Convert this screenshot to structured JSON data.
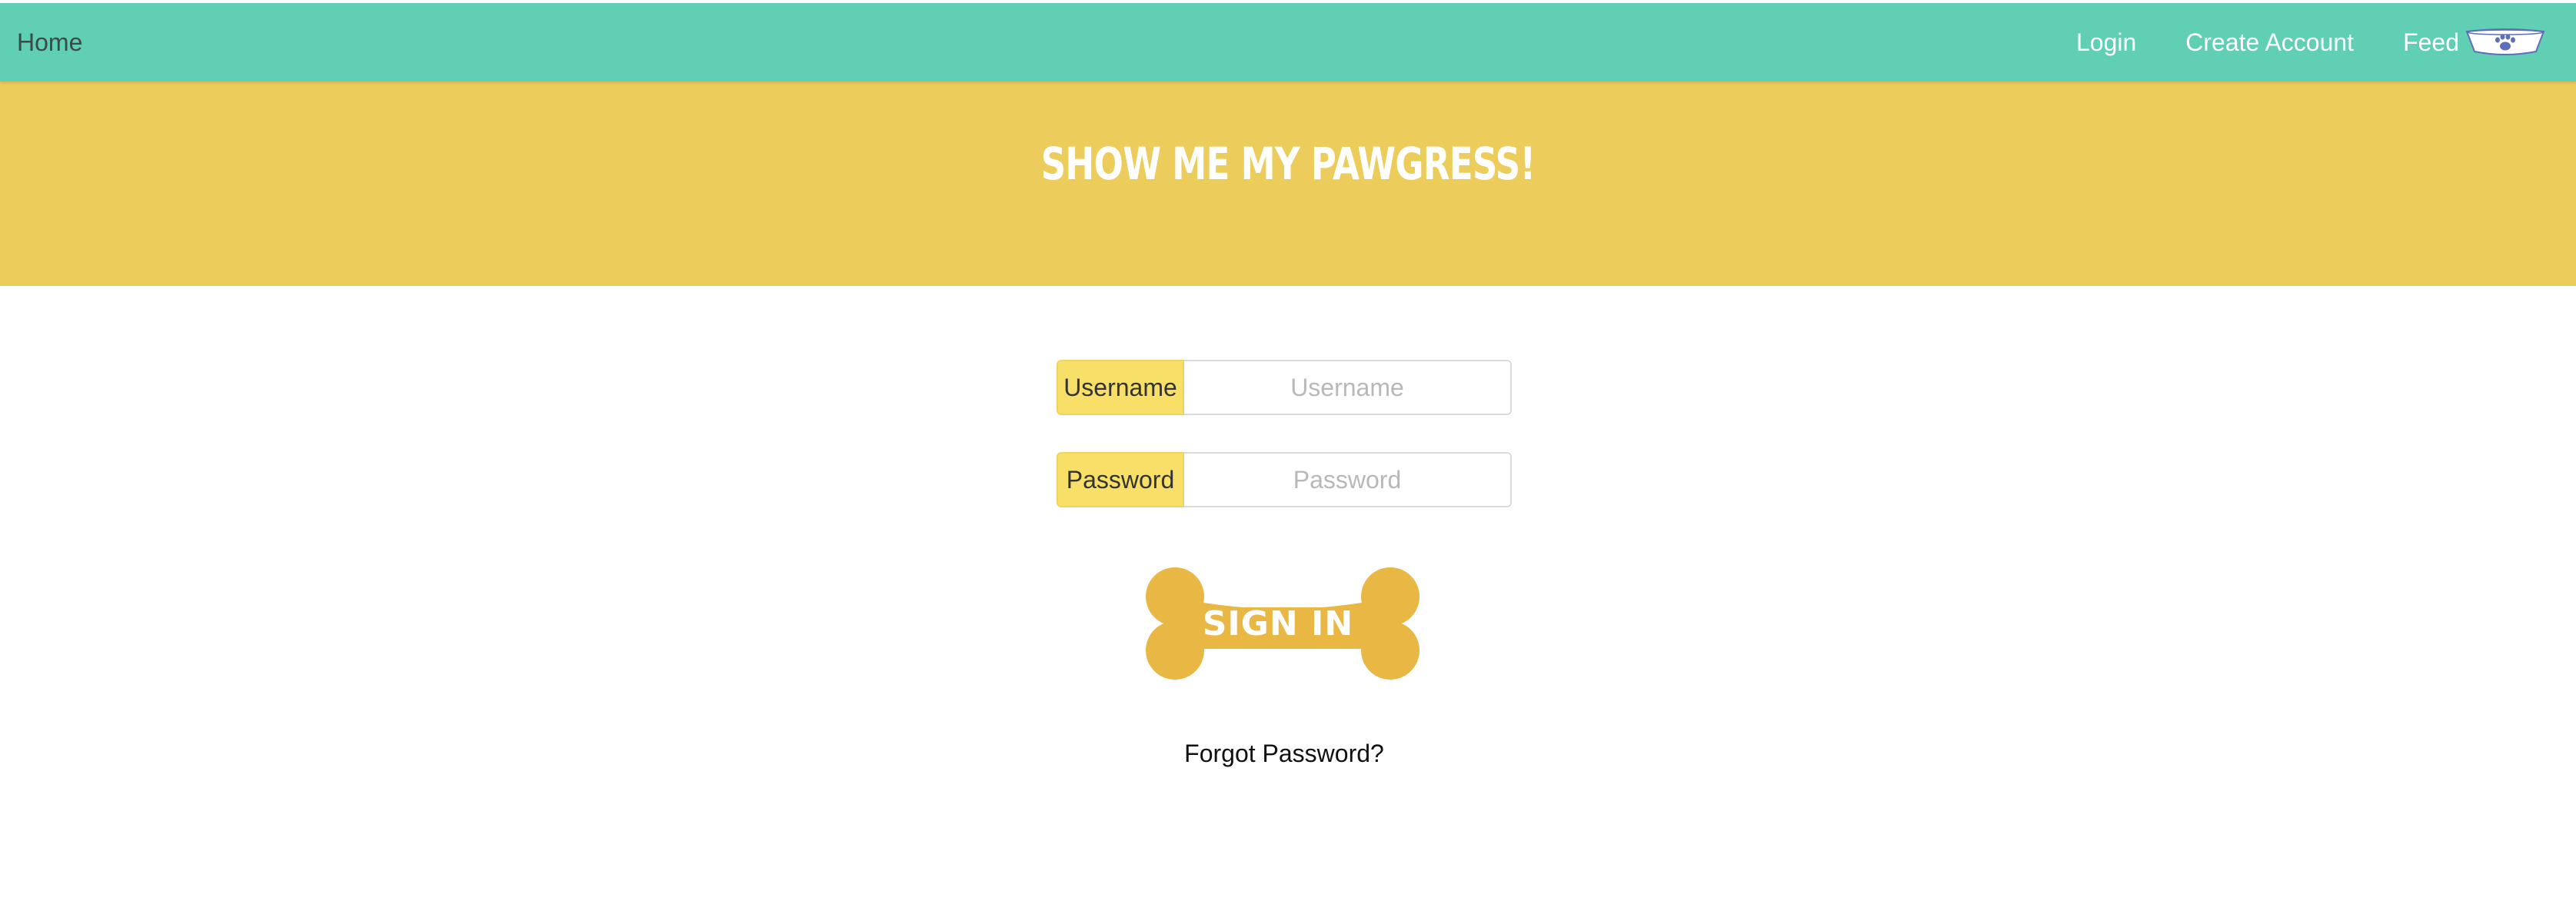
{
  "nav": {
    "home_label": "Home",
    "login_label": "Login",
    "create_account_label": "Create Account",
    "feed_label": "Feed",
    "feed_icon": "paw-bowl-icon",
    "background_color": "#60cfb4"
  },
  "hero": {
    "title": "SHOW ME MY PAWGRESS!",
    "background_color": "#eccc5a"
  },
  "form": {
    "username": {
      "label": "Username",
      "placeholder": "Username",
      "value": ""
    },
    "password": {
      "label": "Password",
      "placeholder": "Password",
      "value": ""
    },
    "signin_label": "SIGN IN",
    "signin_color": "#e9b743",
    "forgot_label": "Forgot Password?"
  }
}
